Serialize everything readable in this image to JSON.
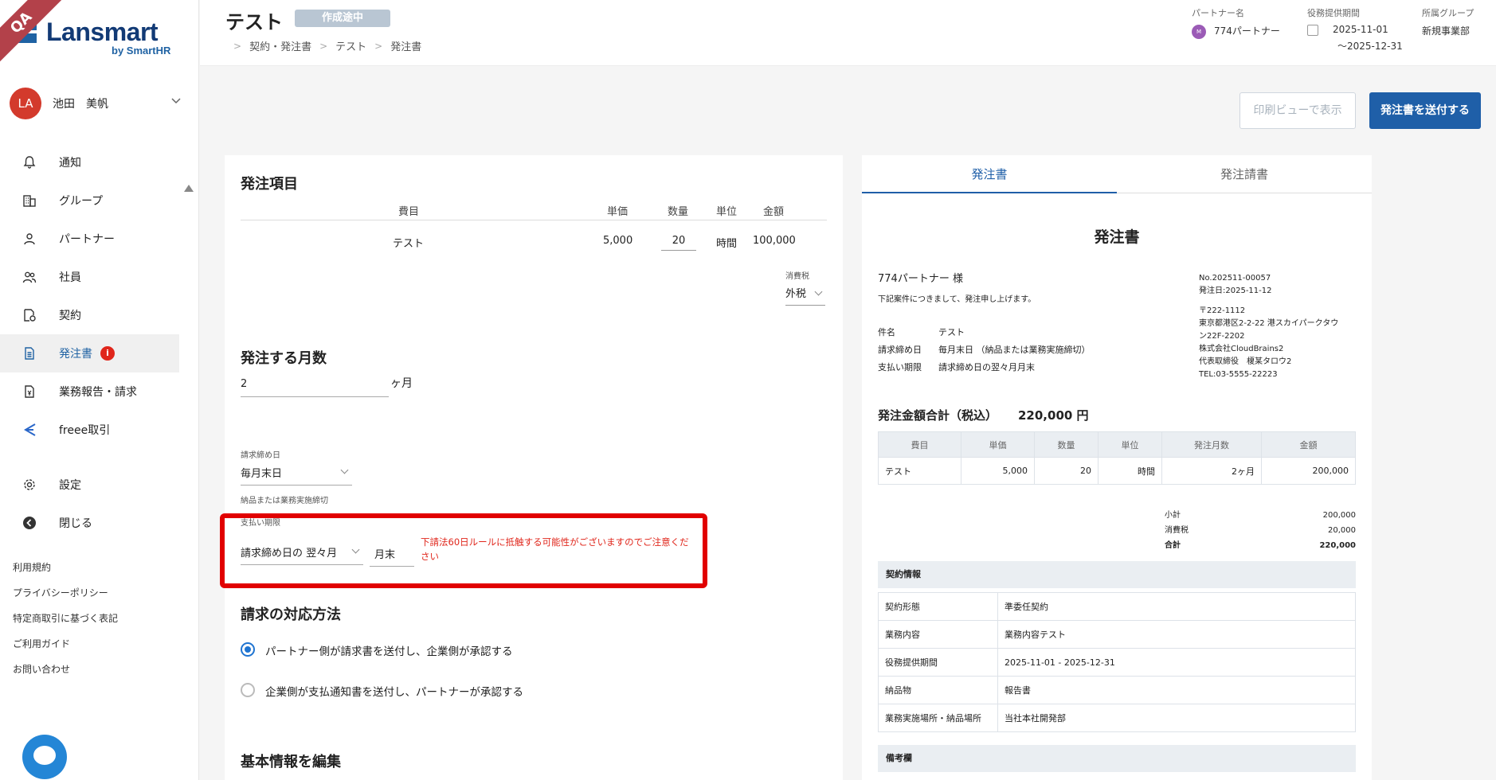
{
  "app": {
    "brand": "Lansmart",
    "brand_sub": "by SmartHR",
    "ribbon": "QA"
  },
  "user": {
    "initials": "LA",
    "name": "池田　美帆"
  },
  "nav": [
    {
      "label": "通知",
      "icon": "bell-icon"
    },
    {
      "label": "グループ",
      "icon": "building-icon"
    },
    {
      "label": "パートナー",
      "icon": "person-icon"
    },
    {
      "label": "社員",
      "icon": "people-icon"
    },
    {
      "label": "契約",
      "icon": "contract-icon"
    },
    {
      "label": "発注書",
      "icon": "document-icon",
      "badge": "i",
      "active": true
    },
    {
      "label": "業務報告・請求",
      "icon": "invoice-icon"
    },
    {
      "label": "freee取引",
      "icon": "freee-icon"
    }
  ],
  "nav2": [
    {
      "label": "設定",
      "icon": "gear-icon"
    },
    {
      "label": "閉じる",
      "icon": "collapse-icon"
    }
  ],
  "footer_links": [
    "利用規約",
    "プライバシーポリシー",
    "特定商取引に基づく表記",
    "ご利用ガイド",
    "お問い合わせ"
  ],
  "header": {
    "title": "テスト",
    "status": "作成途中",
    "breadcrumb": [
      "契約・発注書",
      "テスト",
      "発注書"
    ],
    "partner_label": "パートナー名",
    "partner_initial": "M",
    "partner_value": "774パートナー",
    "period_label": "役務提供期間",
    "period_start": "2025-11-01",
    "period_end": "〜2025-12-31",
    "group_label": "所属グループ",
    "group_value": "新規事業部"
  },
  "actions": {
    "print_view": "印刷ビューで表示",
    "send": "発注書を送付する"
  },
  "order_items": {
    "title": "発注項目",
    "columns": [
      "費目",
      "単価",
      "数量",
      "単位",
      "金額"
    ],
    "row": {
      "item": "テスト",
      "unit_price": "5,000",
      "qty": "20",
      "unit": "時間",
      "amount": "100,000"
    },
    "tax_label": "消費税",
    "tax_value": "外税"
  },
  "months": {
    "title": "発注する月数",
    "value": "2",
    "suffix": "ヶ月"
  },
  "closing": {
    "label": "請求締め日",
    "value": "毎月末日",
    "hint": "納品または業務実施締切"
  },
  "payment": {
    "label": "支払い期限",
    "select": "請求締め日の 翌々月",
    "day": "月末",
    "warning": "下請法60日ルールに抵触する可能性がございますのでご注意ください"
  },
  "billing_method": {
    "title": "請求の対応方法",
    "options": [
      {
        "label": "パートナー側が請求書を送付し、企業側が承認する",
        "checked": true
      },
      {
        "label": "企業側が支払通知書を送付し、パートナーが承認する",
        "checked": false
      }
    ]
  },
  "basic_info": {
    "title": "基本情報を編集"
  },
  "preview": {
    "tabs": [
      "発注書",
      "発注請書"
    ],
    "doc_title": "発注書",
    "recipient": "774パートナー 様",
    "greeting": "下記案件につきまして、発注申し上げます。",
    "meta": [
      {
        "k": "件名",
        "v": "テスト"
      },
      {
        "k": "請求締め日",
        "v": "毎月末日 （納品または業務実施締切）"
      },
      {
        "k": "支払い期限",
        "v": "請求締め日の翌々月月末"
      }
    ],
    "issuer": {
      "no": "No.202511-00057",
      "date": "発注日:2025-11-12",
      "zip": "〒222-1112",
      "addr1": "東京都港区2-2-22 港スカイパークタウ",
      "addr2": "ン22F-2202",
      "company": "株式会社CloudBrains2",
      "rep": "代表取締役　榎某タロウ2",
      "tel": "TEL:03-5555-22223"
    },
    "total_label": "発注金額合計（税込）",
    "total_value": "220,000 円",
    "table_columns": [
      "費目",
      "単価",
      "数量",
      "単位",
      "発注月数",
      "金額"
    ],
    "table_row": [
      "テスト",
      "5,000",
      "20",
      "時間",
      "2ヶ月",
      "200,000"
    ],
    "subtotal_label": "小計",
    "subtotal": "200,000",
    "tax_label": "消費税",
    "tax": "20,000",
    "grand_label": "合計",
    "grand": "220,000",
    "contract_head": "契約情報",
    "contract": [
      {
        "k": "契約形態",
        "v": "準委任契約"
      },
      {
        "k": "業務内容",
        "v": "業務内容テスト"
      },
      {
        "k": "役務提供期間",
        "v": "2025-11-01 - 2025-12-31"
      },
      {
        "k": "納品物",
        "v": "報告書"
      },
      {
        "k": "業務実施場所・納品場所",
        "v": "当社本社開発部"
      }
    ],
    "remarks_head": "備考欄"
  }
}
